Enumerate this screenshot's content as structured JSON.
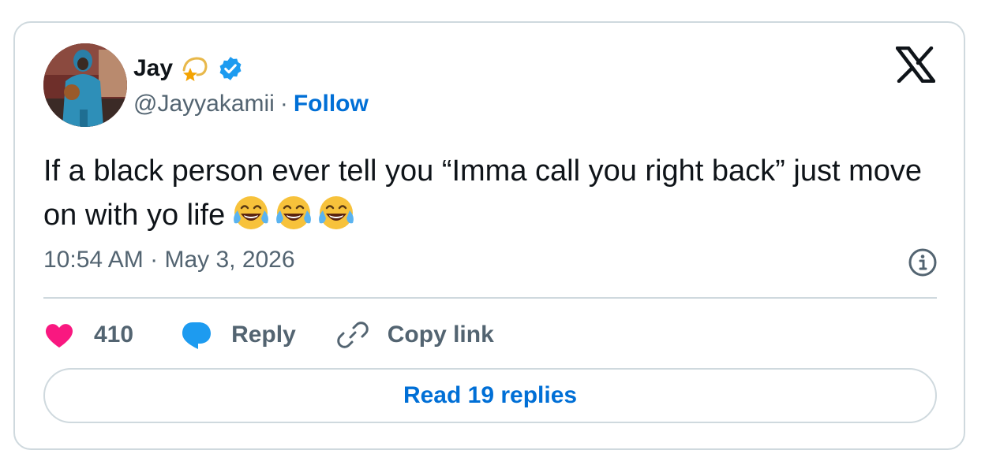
{
  "author": {
    "name": "Jay",
    "handle": "@Jayyakamii",
    "separator": "·",
    "follow_label": "Follow",
    "verified": true,
    "name_emoji": "dizzy-star",
    "avatar": "profile-photo"
  },
  "tweet": {
    "text": "If a black person ever tell you “Imma call you right back” just move on with yo life",
    "emojis": [
      "face-with-tears-of-joy",
      "face-with-tears-of-joy",
      "face-with-tears-of-joy"
    ],
    "time": "10:54 AM",
    "date_separator": "·",
    "date": "May 3, 2026"
  },
  "actions": {
    "like_count": "410",
    "reply_label": "Reply",
    "copy_link_label": "Copy link"
  },
  "read_replies_label": "Read 19 replies",
  "colors": {
    "accent": "#006fd6",
    "verified": "#1d9bf0",
    "like": "#f91880",
    "reply_icon": "#1d9bf0",
    "muted": "#536471",
    "border": "#cfd9de",
    "text": "#0f1419"
  },
  "icons": {
    "logo": "x-logo",
    "info": "info-icon",
    "like": "heart-icon",
    "reply": "speech-bubble-icon",
    "copy": "link-icon"
  }
}
